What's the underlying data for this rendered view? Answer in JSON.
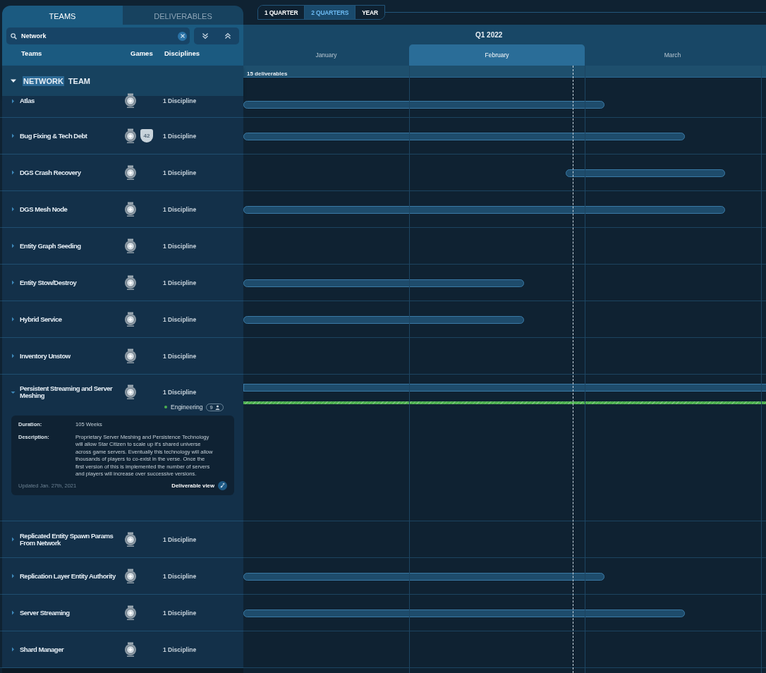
{
  "tabs": [
    {
      "label": "TEAMS",
      "selected": true
    },
    {
      "label": "DELIVERABLES",
      "selected": false
    }
  ],
  "search": {
    "value": "Network"
  },
  "columns": [
    "Teams",
    "Games",
    "Disciplines"
  ],
  "group": {
    "expanded": true,
    "title_parts": [
      {
        "text": "NETWORK",
        "highlighted": true
      },
      {
        "text": "TEAM",
        "highlighted": false
      }
    ]
  },
  "rows": [
    {
      "name": "Atlas",
      "games": [
        {
          "kind": "medal"
        }
      ],
      "disciplines": "1 Discipline",
      "expanded": false
    },
    {
      "name": "Bug Fixing & Tech Debt",
      "games": [
        {
          "kind": "medal"
        },
        {
          "kind": "shield",
          "label": "42"
        }
      ],
      "disciplines": "1 Discipline",
      "expanded": false
    },
    {
      "name": "DGS Crash Recovery",
      "games": [
        {
          "kind": "medal"
        }
      ],
      "disciplines": "1 Discipline",
      "expanded": false
    },
    {
      "name": "DGS Mesh Node",
      "games": [
        {
          "kind": "medal"
        }
      ],
      "disciplines": "1 Discipline",
      "expanded": false
    },
    {
      "name": "Entity Graph Seeding",
      "games": [
        {
          "kind": "medal"
        }
      ],
      "disciplines": "1 Discipline",
      "expanded": false
    },
    {
      "name": "Entity Stow/Destroy",
      "games": [
        {
          "kind": "medal"
        }
      ],
      "disciplines": "1 Discipline",
      "expanded": false
    },
    {
      "name": "Hybrid Service",
      "games": [
        {
          "kind": "medal"
        }
      ],
      "disciplines": "1 Discipline",
      "expanded": false
    },
    {
      "name": "Inventory Unstow",
      "games": [
        {
          "kind": "medal"
        }
      ],
      "disciplines": "1 Discipline",
      "expanded": false
    },
    {
      "name": "Persistent Streaming and Server Meshing",
      "games": [
        {
          "kind": "medal"
        }
      ],
      "disciplines": "1 Discipline",
      "expanded": true,
      "details": {
        "discipline": {
          "name": "Engineering",
          "color": "#4caf50",
          "count": "9"
        },
        "duration_label": "Duration:",
        "duration": "105 Weeks",
        "description_label": "Description:",
        "description": "Proprietary Server Meshing and Persistence Technology will allow Star Citizen to scale up it's shared universe across game servers. Eventually this technology will allow thousands of players to co-exist in the verse. Once the first version of this is implemented the number of servers and players will increase over successive versions.",
        "updated": "Updated Jan. 27th, 2021",
        "link": "Deliverable view"
      }
    },
    {
      "name": "Replicated Entity Spawn Params From Network",
      "games": [
        {
          "kind": "medal"
        }
      ],
      "disciplines": "1 Discipline",
      "expanded": false
    },
    {
      "name": "Replication Layer Entity Authority",
      "games": [
        {
          "kind": "medal"
        }
      ],
      "disciplines": "1 Discipline",
      "expanded": false
    },
    {
      "name": "Server Streaming",
      "games": [
        {
          "kind": "medal"
        }
      ],
      "disciplines": "1 Discipline",
      "expanded": false
    },
    {
      "name": "Shard Manager",
      "games": [
        {
          "kind": "medal"
        }
      ],
      "disciplines": "1 Discipline",
      "expanded": false
    }
  ],
  "timeline": {
    "views": [
      {
        "label": "1 QUARTER",
        "selected": false
      },
      {
        "label": "2 QUARTERS",
        "selected": true
      },
      {
        "label": "YEAR",
        "selected": false
      }
    ],
    "quarter": "Q1 2022",
    "months": [
      {
        "label": "January",
        "selected": false
      },
      {
        "label": "February",
        "selected": true
      },
      {
        "label": "March",
        "selected": false
      }
    ],
    "summary": "15 deliverables"
  }
}
